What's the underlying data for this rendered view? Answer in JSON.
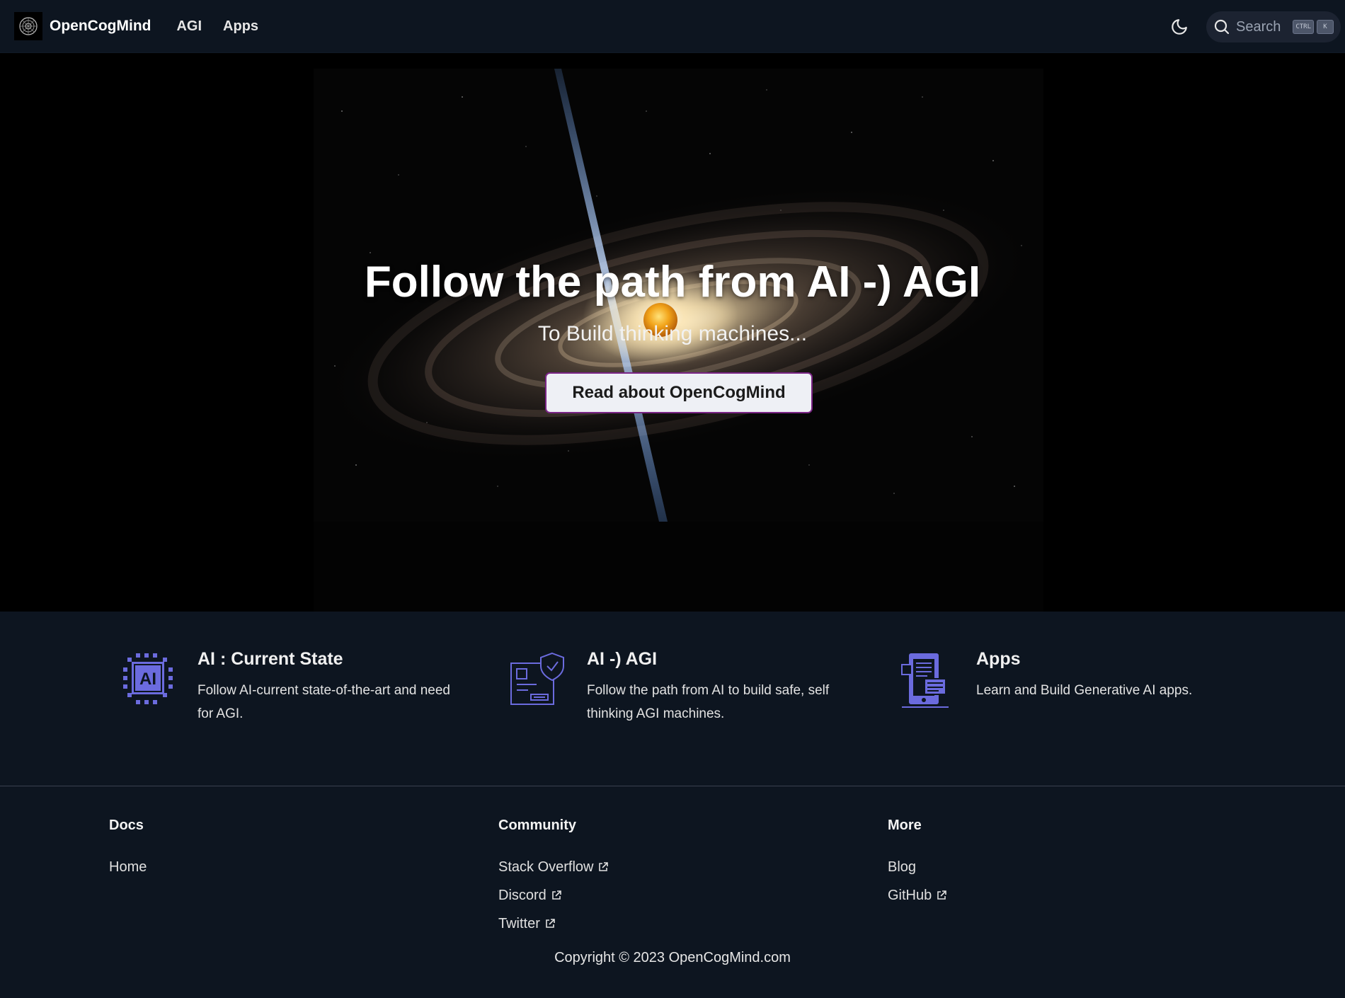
{
  "navbar": {
    "brand": "OpenCogMind",
    "links": [
      {
        "label": "AGI"
      },
      {
        "label": "Apps"
      }
    ],
    "search": {
      "label": "Search",
      "shortcut_ctrl": "CTRL",
      "shortcut_key": "K"
    },
    "icons": {
      "logo": "opencogmind-logo-icon",
      "theme": "moon-icon",
      "search": "search-icon"
    }
  },
  "hero": {
    "title": "Follow the path from AI -) AGI",
    "subtitle": "To Build thinking machines...",
    "button_label": "Read about OpenCogMind",
    "image": "galaxy-with-light-jet"
  },
  "features": [
    {
      "icon": "ai-chip-icon",
      "title": "AI : Current State",
      "description": "Follow AI-current state-of-the-art and need for AGI."
    },
    {
      "icon": "secure-board-icon",
      "title": "AI -) AGI",
      "description": "Follow the path from AI to build safe, self thinking AGI machines."
    },
    {
      "icon": "mobile-app-icon",
      "title": "Apps",
      "description": "Learn and Build Generative AI apps."
    }
  ],
  "footer": {
    "columns": [
      {
        "heading": "Docs",
        "links": [
          {
            "label": "Home",
            "external": false
          }
        ]
      },
      {
        "heading": "Community",
        "links": [
          {
            "label": "Stack Overflow",
            "external": true
          },
          {
            "label": "Discord",
            "external": true
          },
          {
            "label": "Twitter",
            "external": true
          }
        ]
      },
      {
        "heading": "More",
        "links": [
          {
            "label": "Blog",
            "external": false
          },
          {
            "label": "GitHub",
            "external": true
          }
        ]
      }
    ],
    "copyright": "Copyright © 2023 OpenCogMind.com"
  },
  "colors": {
    "background": "#0d1520",
    "accent": "#6b6bde",
    "button_border": "#7a2586"
  }
}
